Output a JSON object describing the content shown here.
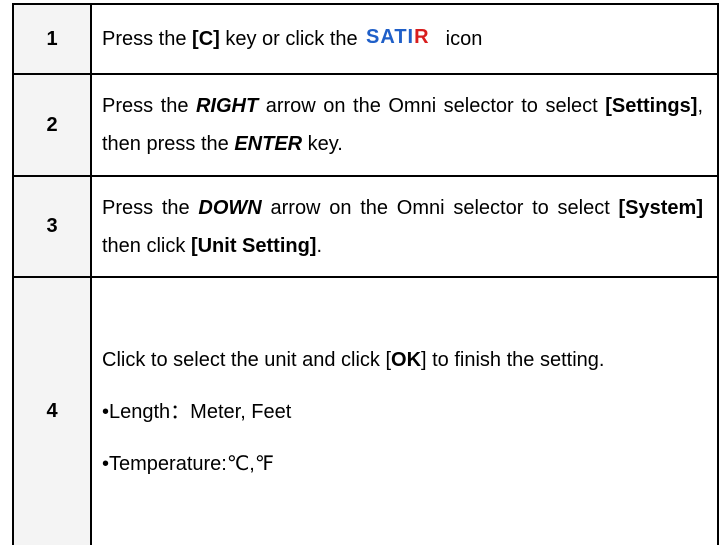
{
  "steps": [
    {
      "number": "1",
      "t1": "Press the ",
      "key": "[C]",
      "t2": " key or click the",
      "icon_text": "SATIR",
      "t3": "icon"
    },
    {
      "number": "2",
      "t1": "Press the ",
      "arrow": "RIGHT",
      "t2": " arrow on the Omni selector to select ",
      "menu": "[Settings]",
      "t3": ", then press the ",
      "key": "ENTER",
      "t4": " key."
    },
    {
      "number": "3",
      "t1": "Press the ",
      "arrow": "DOWN",
      "t2": " arrow on the Omni selector to select ",
      "menu": "[System]",
      "t3": " then click ",
      "item": "[Unit Setting]",
      "t4": "."
    },
    {
      "number": "4",
      "t1": "Click to select the unit and click [",
      "ok": "OK",
      "t2": "] to finish the setting.",
      "length": "•Length：Meter, Feet",
      "temperature": "•Temperature:℃,℉"
    }
  ],
  "colors": {
    "logo_blue": "#1f5fc8",
    "logo_red": "#d81e1e"
  }
}
